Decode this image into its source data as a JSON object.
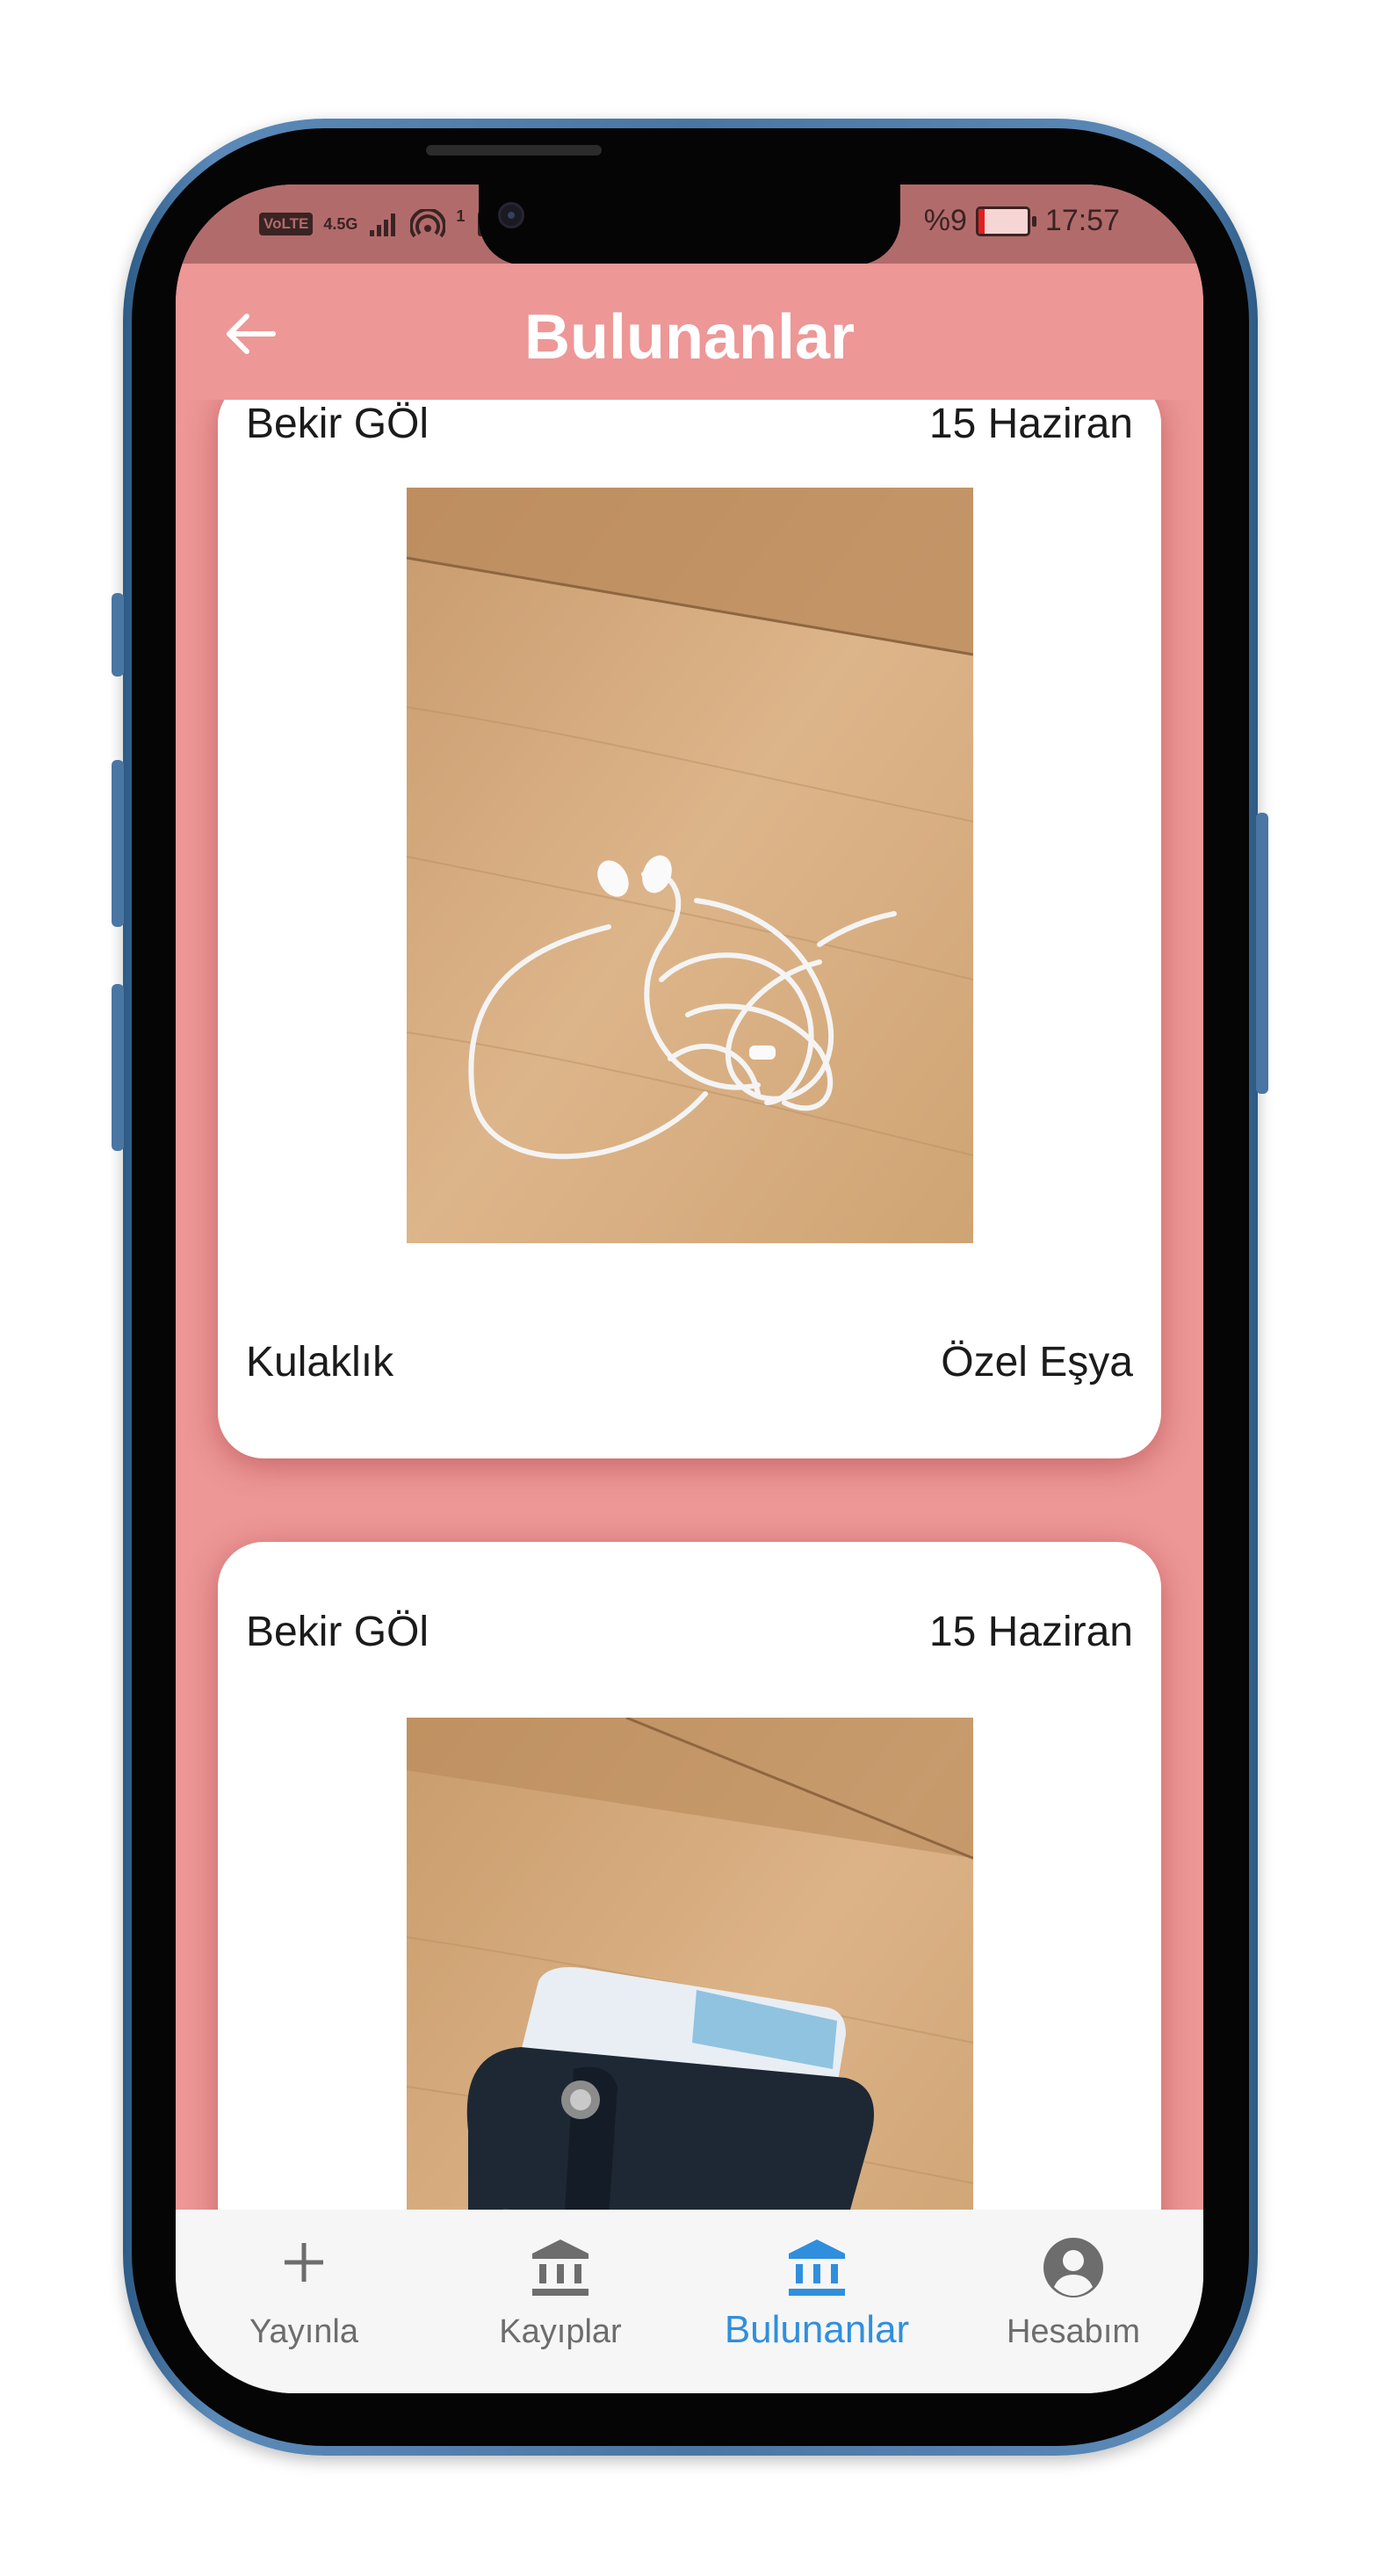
{
  "status_bar": {
    "volte": "VoLTE",
    "network": "4.5G",
    "sim_count": "1",
    "battery_percent": "%9",
    "battery_level": 0.09,
    "time": "17:57"
  },
  "header": {
    "title": "Bulunanlar"
  },
  "cards": [
    {
      "owner": "Bekir GÖl",
      "date": "15 Haziran",
      "item_name": "Kulaklık",
      "category": "Özel Eşya",
      "photo": "earphones-photo"
    },
    {
      "owner": "Bekir GÖl",
      "date": "15 Haziran",
      "photo": "wallet-photo"
    }
  ],
  "bottom_nav": {
    "items": [
      {
        "label": "Yayınla",
        "icon": "plus-icon"
      },
      {
        "label": "Kayıplar",
        "icon": "bank-icon"
      },
      {
        "label": "Bulunanlar",
        "icon": "bank-icon"
      },
      {
        "label": "Hesabım",
        "icon": "account-circle-icon"
      }
    ],
    "active_index": 2
  },
  "colors": {
    "app_bar": "#ed9797",
    "status_bar": "#b26b6b",
    "active_nav": "#2f8fde",
    "inactive_nav": "#6d6d6d",
    "card": "#ffffff",
    "phone_frame": "#4a76a3"
  }
}
